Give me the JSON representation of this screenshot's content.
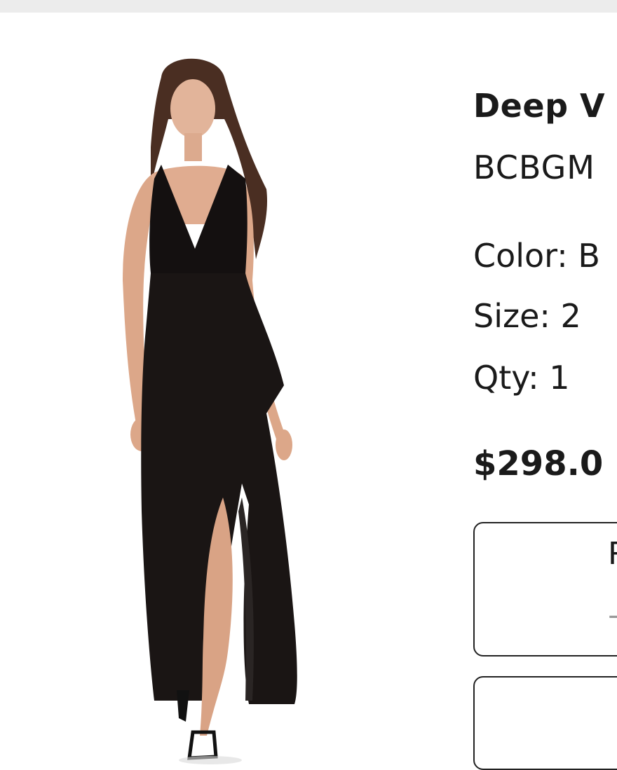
{
  "product": {
    "title": "Deep V",
    "brand": "BCBGM",
    "color_label": "Color: B",
    "size_label": "Size: 2",
    "qty_label": "Qty: 1",
    "price": "$298.0",
    "image_alt": "black-deep-v-maxi-dress-photo"
  },
  "actions": {
    "primary_label": "R",
    "primary_icon": "arrow-icon",
    "secondary_label": ""
  }
}
